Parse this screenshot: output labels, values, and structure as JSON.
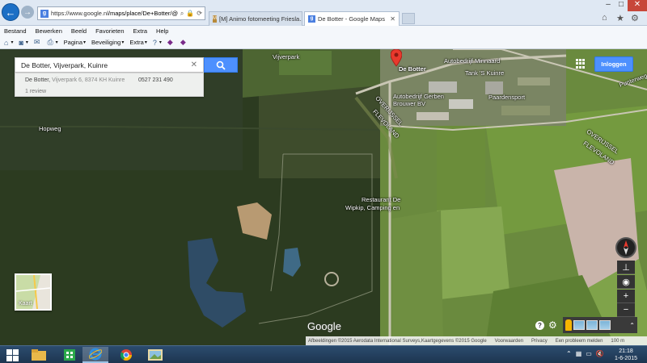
{
  "browser": {
    "url_host": "https://www.google.nl",
    "url_path": "/maps/place/De+Botter/@5",
    "tabs": [
      {
        "label": "[M] Animo fotomeeting Friesla...",
        "active": false
      },
      {
        "label": "De Botter - Google Maps",
        "active": true
      }
    ],
    "menu": [
      "Bestand",
      "Bewerken",
      "Beeld",
      "Favorieten",
      "Extra",
      "Help"
    ],
    "commands": [
      {
        "label": "Pagina",
        "icon": "page-icon"
      },
      {
        "label": "Beveiliging",
        "icon": "shield-icon"
      },
      {
        "label": "Extra",
        "icon": "gear-icon"
      }
    ]
  },
  "maps": {
    "search_value": "De Botter, Vijverpark, Kuinre",
    "result": {
      "name": "De Botter,",
      "address": "Vijverpark 6, 8374 KH Kuinre",
      "phone": "0527 231 490",
      "reviews": "1 review"
    },
    "login_label": "Inloggen",
    "minimap_label": "Kaart",
    "logo": "Google",
    "labels": {
      "place": "De Botter",
      "vijverpark": "Vijverpark",
      "business1": "Autobedrijf Minnaard",
      "business2": "Tank 'S Kuinre",
      "business3_l1": "Autobedrijf Gerben",
      "business3_l2": "Brouwer BV",
      "business4": "Paardensport",
      "restaurant_l1": "Restaurant De",
      "restaurant_l2": "Wipkip, Camping en",
      "street1": "Hopweg",
      "street2": "Punterweg",
      "road1": "OVERIJSSEL",
      "road2": "FLEVOLAND",
      "road3": "OVERIJSSEL",
      "road4": "FLEVOLAND",
      "ghost": "OVERIJSSEL"
    },
    "attribution": [
      "Afbeeldingen ©2015 Aerodata International Surveys,Kaartgegevens ©2015 Google",
      "Voorwaarden",
      "Privacy",
      "Een probleem melden",
      "100 m"
    ]
  },
  "taskbar": {
    "time": "21:18",
    "date": "1-6-2015"
  }
}
